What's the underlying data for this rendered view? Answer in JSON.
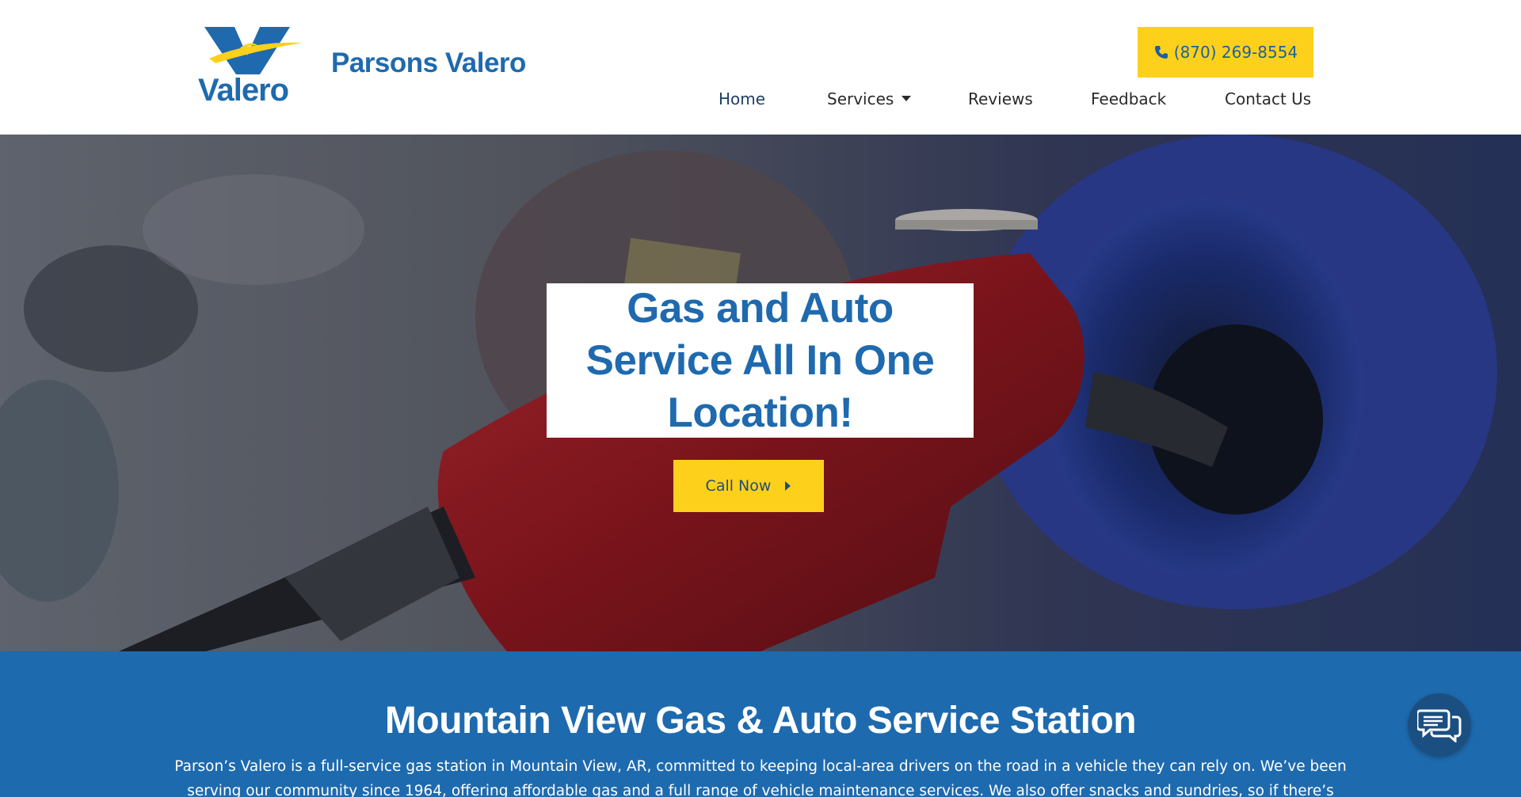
{
  "header": {
    "logo_text": "Valero",
    "site_name": "Parsons Valero",
    "phone": "(870) 269-8554"
  },
  "nav": {
    "items": [
      {
        "label": "Home",
        "active": true
      },
      {
        "label": "Services",
        "has_dropdown": true
      },
      {
        "label": "Reviews"
      },
      {
        "label": "Feedback"
      },
      {
        "label": "Contact Us"
      }
    ]
  },
  "hero": {
    "title": "Gas and Auto Service All In One Location!",
    "cta_label": "Call Now"
  },
  "intro": {
    "heading": "Mountain View Gas & Auto Service Station",
    "body": "Parson’s Valero is a full-service gas station in Mountain View, AR, committed to keeping local-area drivers on the road in a vehicle they can rely on. We’ve been serving our community since 1964, offering affordable gas and a full range of vehicle maintenance services. We also offer snacks and sundries, so if there’s anything you need on the"
  },
  "icons": {
    "phone": "phone-icon",
    "caret": "caret-down-icon",
    "arrow": "caret-right-icon",
    "chat": "chat-icon"
  },
  "colors": {
    "brand_blue": "#1f6aae",
    "accent_yellow": "#fdd11b",
    "band_blue": "#1e6aae",
    "chat_blue": "#1b4f82"
  }
}
